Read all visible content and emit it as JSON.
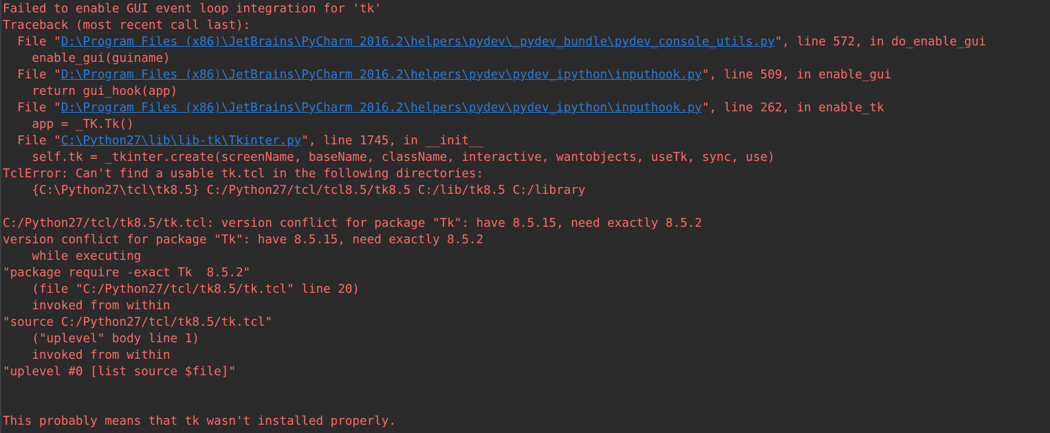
{
  "console": {
    "lines": [
      {
        "segments": [
          {
            "text": "Failed to enable GUI event loop integration for 'tk'",
            "link": false
          }
        ]
      },
      {
        "segments": [
          {
            "text": "Traceback (most recent call last):",
            "link": false
          }
        ]
      },
      {
        "segments": [
          {
            "text": "  File \"",
            "link": false
          },
          {
            "text": "D:\\Program Files (x86)\\JetBrains\\PyCharm 2016.2\\helpers\\pydev\\_pydev_bundle\\pydev_console_utils.py",
            "link": true
          },
          {
            "text": "\", line 572, in do_enable_gui",
            "link": false
          }
        ]
      },
      {
        "segments": [
          {
            "text": "    enable_gui(guiname)",
            "link": false
          }
        ]
      },
      {
        "segments": [
          {
            "text": "  File \"",
            "link": false
          },
          {
            "text": "D:\\Program Files (x86)\\JetBrains\\PyCharm 2016.2\\helpers\\pydev\\pydev_ipython\\inputhook.py",
            "link": true
          },
          {
            "text": "\", line 509, in enable_gui",
            "link": false
          }
        ]
      },
      {
        "segments": [
          {
            "text": "    return gui_hook(app)",
            "link": false
          }
        ]
      },
      {
        "segments": [
          {
            "text": "  File \"",
            "link": false
          },
          {
            "text": "D:\\Program Files (x86)\\JetBrains\\PyCharm 2016.2\\helpers\\pydev\\pydev_ipython\\inputhook.py",
            "link": true
          },
          {
            "text": "\", line 262, in enable_tk",
            "link": false
          }
        ]
      },
      {
        "segments": [
          {
            "text": "    app = _TK.Tk()",
            "link": false
          }
        ]
      },
      {
        "segments": [
          {
            "text": "  File \"",
            "link": false
          },
          {
            "text": "C:\\Python27\\lib\\lib-tk\\Tkinter.py",
            "link": true
          },
          {
            "text": "\", line 1745, in __init__",
            "link": false
          }
        ]
      },
      {
        "segments": [
          {
            "text": "    self.tk = _tkinter.create(screenName, baseName, className, interactive, wantobjects, useTk, sync, use)",
            "link": false
          }
        ]
      },
      {
        "segments": [
          {
            "text": "TclError: Can't find a usable tk.tcl in the following directories:",
            "link": false
          }
        ]
      },
      {
        "segments": [
          {
            "text": "    {C:\\Python27\\tcl\\tk8.5} C:/Python27/tcl/tcl8.5/tk8.5 C:/lib/tk8.5 C:/library",
            "link": false
          }
        ]
      },
      {
        "segments": [
          {
            "text": "",
            "link": false
          }
        ]
      },
      {
        "segments": [
          {
            "text": "C:/Python27/tcl/tk8.5/tk.tcl: version conflict for package \"Tk\": have 8.5.15, need exactly 8.5.2",
            "link": false
          }
        ]
      },
      {
        "segments": [
          {
            "text": "version conflict for package \"Tk\": have 8.5.15, need exactly 8.5.2",
            "link": false
          }
        ]
      },
      {
        "segments": [
          {
            "text": "    while executing",
            "link": false
          }
        ]
      },
      {
        "segments": [
          {
            "text": "\"package require -exact Tk  8.5.2\"",
            "link": false
          }
        ]
      },
      {
        "segments": [
          {
            "text": "    (file \"C:/Python27/tcl/tk8.5/tk.tcl\" line 20)",
            "link": false
          }
        ]
      },
      {
        "segments": [
          {
            "text": "    invoked from within",
            "link": false
          }
        ]
      },
      {
        "segments": [
          {
            "text": "\"source C:/Python27/tcl/tk8.5/tk.tcl\"",
            "link": false
          }
        ]
      },
      {
        "segments": [
          {
            "text": "    (\"uplevel\" body line 1)",
            "link": false
          }
        ]
      },
      {
        "segments": [
          {
            "text": "    invoked from within",
            "link": false
          }
        ]
      },
      {
        "segments": [
          {
            "text": "\"uplevel #0 [list source $file]\"",
            "link": false
          }
        ]
      },
      {
        "segments": [
          {
            "text": "",
            "link": false
          }
        ]
      },
      {
        "segments": [
          {
            "text": "",
            "link": false
          }
        ]
      },
      {
        "segments": [
          {
            "text": "This probably means that tk wasn't installed properly.",
            "link": false
          }
        ]
      }
    ]
  },
  "colors": {
    "background": "#2b2b2b",
    "error_text": "#ff6b68",
    "link": "#287bde"
  }
}
